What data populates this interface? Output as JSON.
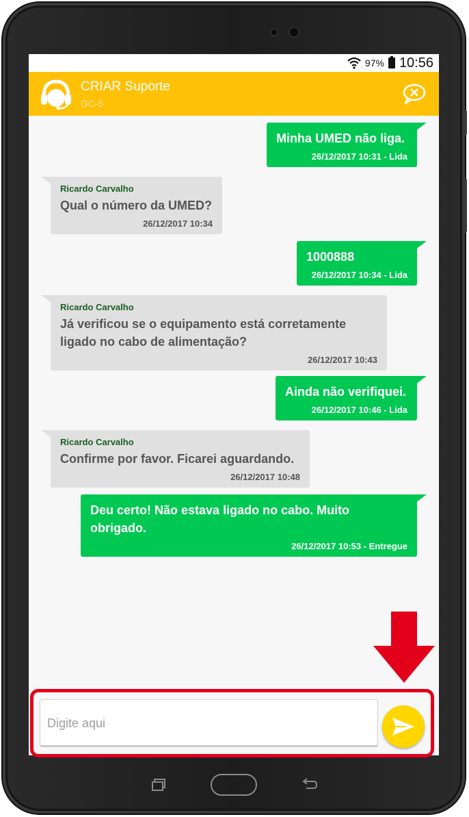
{
  "status_bar": {
    "battery": "97%",
    "time": "10:56"
  },
  "app_bar": {
    "title": "CRIAR Suporte",
    "subtitle": "GC-5"
  },
  "messages": [
    {
      "text": "Minha UMED não liga.",
      "meta": "26/12/2017 10:31 - Lida"
    },
    {
      "sender": "Ricardo Carvalho",
      "text": "Qual o número da UMED?",
      "meta": "26/12/2017 10:34"
    },
    {
      "text": "1000888",
      "meta": "26/12/2017 10:34 - Lida"
    },
    {
      "sender": "Ricardo Carvalho",
      "text": "Já verificou se o equipamento está corretamente ligado no cabo de alimentação?",
      "meta": "26/12/2017 10:43"
    },
    {
      "text": "Ainda não verifiquei.",
      "meta": "26/12/2017 10:46 - Lida"
    },
    {
      "sender": "Ricardo Carvalho",
      "text": "Confirme por favor. Ficarei aguardando.",
      "meta": "26/12/2017 10:48"
    },
    {
      "text": "Deu certo! Não estava ligado no cabo. Muito obrigado.",
      "meta": "26/12/2017 10:53 - Entregue"
    }
  ],
  "input": {
    "placeholder": "Digite aqui",
    "value": ""
  },
  "colors": {
    "app_bar": "#ffc107",
    "outgoing_bubble": "#00c853",
    "incoming_bubble": "#e0e0e0",
    "sender_name": "#1b5e20",
    "send_button": "#ffd600",
    "highlight": "#e3001b"
  },
  "icons": {
    "app": "headset-icon",
    "close_chat": "close-chat-icon",
    "send": "send-icon",
    "wifi": "wifi-icon",
    "battery": "battery-icon"
  }
}
